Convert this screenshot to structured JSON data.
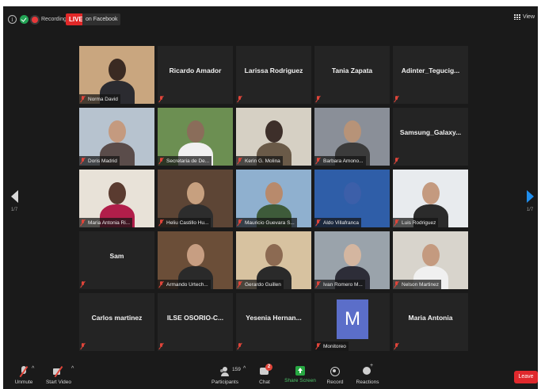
{
  "topbar": {
    "info_glyph": "i",
    "recording_label": "Recording",
    "live_badge": "LIVE",
    "live_destination": "on Facebook",
    "view_label": "View"
  },
  "pagination": {
    "left_page": "1/7",
    "right_page": "1/7"
  },
  "tiles": [
    {
      "name": "Norma David",
      "video": true
    },
    {
      "name": "Ricardo Amador",
      "video": false
    },
    {
      "name": "Larissa Rodriguez",
      "video": false
    },
    {
      "name": "Tania Zapata",
      "video": false
    },
    {
      "name": "Adinter_Tegucig...",
      "video": false
    },
    {
      "name": "Doris Madrid",
      "video": true
    },
    {
      "name": "Secretaria de De...",
      "video": true
    },
    {
      "name": "Kerin G. Molina",
      "video": true
    },
    {
      "name": "Barbara Amono...",
      "video": true
    },
    {
      "name": "Samsung_Galaxy...",
      "video": false
    },
    {
      "name": "Maria Antonia Ri...",
      "video": true
    },
    {
      "name": "Heliu Castillo Hu...",
      "video": true
    },
    {
      "name": "Mauricio Guevara S...",
      "video": true,
      "speaking": true
    },
    {
      "name": "Aldo Villafranca",
      "video": true
    },
    {
      "name": "Luis Rodriguez",
      "video": true
    },
    {
      "name": "Sam",
      "video": false
    },
    {
      "name": "Armando Urtech...",
      "video": true
    },
    {
      "name": "Gerardo Guillen",
      "video": true
    },
    {
      "name": "Ivan Romero M...",
      "video": true
    },
    {
      "name": "Nelson Martinez",
      "video": true
    },
    {
      "name": "Carlos martinez",
      "video": false
    },
    {
      "name": "ILSE OSORIO-C...",
      "video": false
    },
    {
      "name": "Yesenia Hernan...",
      "video": false
    },
    {
      "name": "Monitoreo",
      "video": true,
      "avatar_letter": "M"
    },
    {
      "name": "Maria Antonia",
      "video": false
    }
  ],
  "toolbar": {
    "unmute_label": "Unmute",
    "start_video_label": "Start Video",
    "participants_label": "Participants",
    "participants_count": "159",
    "chat_label": "Chat",
    "chat_badge": "2",
    "share_label": "Share Screen",
    "record_label": "Record",
    "reactions_label": "Reactions",
    "leave_label": "Leave",
    "caret_glyph": "^"
  },
  "colors": {
    "live_red": "#e02828",
    "share_green": "#27a842",
    "active_speaker": "#e3e52f",
    "next_arrow": "#1f8ded",
    "avatar_blue": "#5b6ec9",
    "leave_red": "#e0292d"
  }
}
